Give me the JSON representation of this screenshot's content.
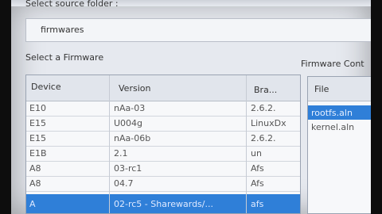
{
  "source_folder": {
    "label": "Select source folder :",
    "value": "firmwares"
  },
  "firmware_list": {
    "label": "Select a Firmware",
    "columns": [
      "Device",
      "Version",
      "Bra..."
    ],
    "rows": [
      {
        "device": "E10",
        "version": "nAa-03",
        "branch": "2.6.2."
      },
      {
        "device": "E15",
        "version": "U004g",
        "branch": "LinuxDx"
      },
      {
        "device": "E15",
        "version": "nAa-06b",
        "branch": "2.6.2."
      },
      {
        "device": "E1B",
        "version": "2.1",
        "branch": "un"
      },
      {
        "device": "A8",
        "version": "03-rc1",
        "branch": "Afs"
      },
      {
        "device": "A8",
        "version": "04.7",
        "branch": "Afs"
      },
      {
        "device": "A",
        "version": "02-rc5 - Sharewards/...",
        "branch": "afs"
      }
    ],
    "selected_index": 6
  },
  "firmware_content": {
    "label": "Firmware Cont",
    "column": "File",
    "files": [
      {
        "name": "rootfs.aln",
        "selected": true
      },
      {
        "name": "kernel.aln",
        "selected": false
      }
    ]
  },
  "colors": {
    "selection": "#2f7fd8",
    "window_bg": "#e6e9ef"
  }
}
